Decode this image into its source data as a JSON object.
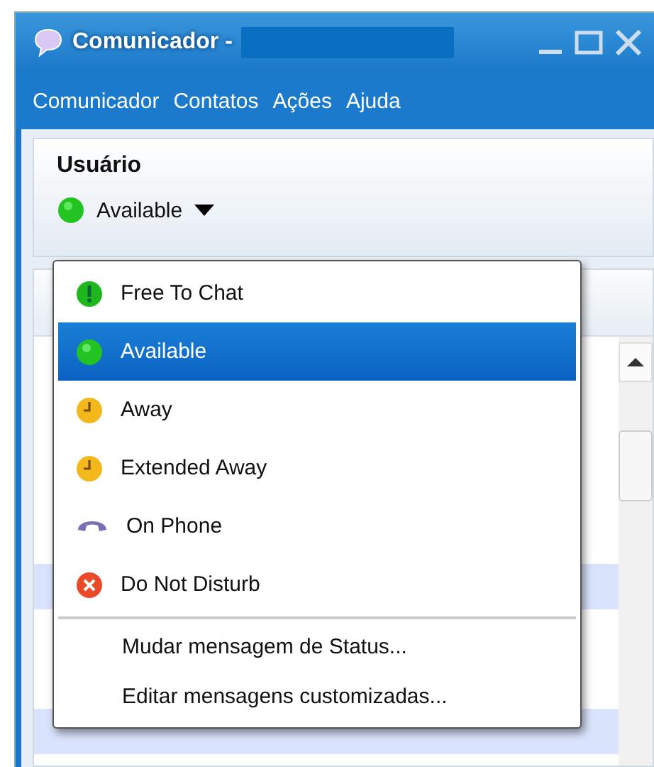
{
  "window": {
    "title": "Comunicador -"
  },
  "menu_bar": [
    {
      "label": "Comunicador"
    },
    {
      "label": "Contatos"
    },
    {
      "label": "Ações"
    },
    {
      "label": "Ajuda"
    }
  ],
  "user": {
    "name": "Usuário",
    "status": "Available"
  },
  "status_menu": {
    "items": [
      {
        "kind": "free",
        "label": "Free To Chat",
        "selected": false
      },
      {
        "kind": "available",
        "label": "Available",
        "selected": true
      },
      {
        "kind": "away",
        "label": "Away",
        "selected": false
      },
      {
        "kind": "away",
        "label": "Extended Away",
        "selected": false
      },
      {
        "kind": "phone",
        "label": "On Phone",
        "selected": false
      },
      {
        "kind": "busy",
        "label": "Do Not Disturb",
        "selected": false
      },
      {
        "kind": "separator"
      },
      {
        "kind": "action",
        "label": "Mudar mensagem de Status..."
      },
      {
        "kind": "action",
        "label": "Editar mensagens customizadas..."
      }
    ]
  }
}
